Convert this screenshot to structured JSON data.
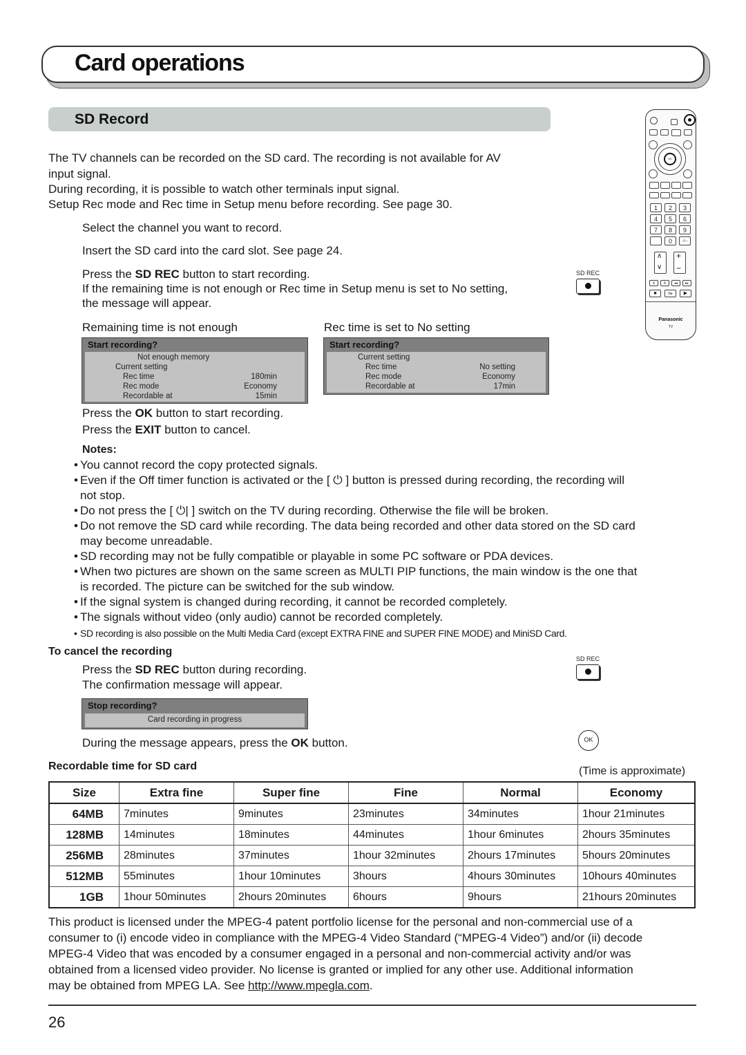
{
  "page": {
    "title": "Card operations",
    "section_title": "SD Record",
    "page_number": "26"
  },
  "intro": {
    "line1": "The TV channels can be recorded on the SD card. The recording is not available for AV",
    "line2": "input signal.",
    "line3": "During recording, it is possible to watch other terminals input signal.",
    "line4": "Setup Rec mode and Rec time in Setup menu before recording. See page 30."
  },
  "steps": {
    "step1": "Select the channel you want to record.",
    "step2": "Insert the SD card into the card slot. See page 24.",
    "step3_pre": "Press the ",
    "step3_bold": "SD REC",
    "step3_post": " button to start recording.",
    "step3_line2": "If the remaining time is not enough or Rec time in Setup menu is set to No setting,",
    "step3_line3": "the message will appear.",
    "caption_left": "Remaining time is not enough",
    "caption_right": "Rec time is set to No setting",
    "ok_pre": "Press the ",
    "ok_bold": "OK",
    "ok_post": " button to start recording.",
    "exit_pre": "Press the ",
    "exit_bold": "EXIT",
    "exit_post": " button to cancel."
  },
  "dialog_not_enough": {
    "title": "Start recording?",
    "message": "Not enough memory",
    "current_setting": "Current setting",
    "rows": [
      {
        "label": "Rec time",
        "value": "180min"
      },
      {
        "label": "Rec mode",
        "value": "Economy"
      },
      {
        "label": "Recordable at",
        "value": "15min"
      }
    ]
  },
  "dialog_no_setting": {
    "title": "Start recording?",
    "current_setting": "Current setting",
    "rows": [
      {
        "label": "Rec time",
        "value": "No setting"
      },
      {
        "label": "Rec mode",
        "value": "Economy"
      },
      {
        "label": "Recordable at",
        "value": "17min"
      }
    ]
  },
  "buttons": {
    "sd_rec_label": "SD REC",
    "ok_label": "OK"
  },
  "notes": {
    "heading": "Notes:",
    "items": [
      "You cannot record the copy protected signals.",
      "Even if the Off timer function is activated or the [ ⏻ ] button is pressed during recording, the recording will",
      "not stop.",
      "Do not press the [ ⏻| ] switch on the TV during recording. Otherwise the file will be broken.",
      "Do not remove the SD card while recording. The data being recorded and other data stored on the SD card",
      "may become unreadable.",
      "SD recording may not be fully compatible or playable in some PC software or PDA devices.",
      "When two pictures are shown on the same screen as MULTI PIP functions, the main window is the one that",
      "is recorded. The picture can be switched for the sub window.",
      "If the signal system is changed during recording, it cannot be recorded completely.",
      "The signals without video (only audio) cannot be recorded completely.",
      "SD recording is also possible on the Multi Media Card (except EXTRA FINE and SUPER FINE MODE) and MiniSD Card."
    ]
  },
  "cancel": {
    "heading": "To cancel the recording",
    "line1_pre": "Press the ",
    "line1_bold": "SD REC",
    "line1_post": " button during recording.",
    "line2": "The confirmation message will appear.",
    "dialog_title": "Stop recording?",
    "dialog_message": "Card recording in progress",
    "line3_pre": "During the message appears, press the ",
    "line3_bold": "OK",
    "line3_post": " button."
  },
  "table": {
    "heading": "Recordable time for SD card",
    "note": "(Time is approximate)",
    "headers": [
      "Size",
      "Extra fine",
      "Super fine",
      "Fine",
      "Normal",
      "Economy"
    ],
    "rows": [
      [
        "64MB",
        "7minutes",
        "9minutes",
        "23minutes",
        "34minutes",
        "1hour 21minutes"
      ],
      [
        "128MB",
        "14minutes",
        "18minutes",
        "44minutes",
        "1hour 6minutes",
        "2hours 35minutes"
      ],
      [
        "256MB",
        "28minutes",
        "37minutes",
        "1hour 32minutes",
        "2hours 17minutes",
        "5hours 20minutes"
      ],
      [
        "512MB",
        "55minutes",
        "1hour 10minutes",
        "3hours",
        "4hours 30minutes",
        "10hours 40minutes"
      ],
      [
        "1GB",
        "1hour 50minutes",
        "2hours 20minutes",
        "6hours",
        "9hours",
        "21hours 20minutes"
      ]
    ]
  },
  "license": {
    "line1": "This product is licensed under the MPEG-4 patent portfolio license for the personal and non-commercial use of a",
    "line2": "consumer to (i) encode video in compliance with the MPEG-4 Video Standard (“MPEG-4 Video”) and/or (ii) decode",
    "line3": "MPEG-4 Video that was encoded by a consumer engaged in a personal and non-commercial activity and/or was",
    "line4": "obtained from a licensed video provider. No license is granted or implied for any other use. Additional information",
    "line5_pre": "may be obtained from MPEG LA. See ",
    "line5_link": "http://www.mpegla.com",
    "line5_post": "."
  },
  "remote": {
    "brand": "Panasonic",
    "model": "TV",
    "ok": "OK",
    "digits": [
      "1",
      "2",
      "3",
      "4",
      "5",
      "6",
      "7",
      "8",
      "9"
    ],
    "zero": "0",
    "dash": "-/--"
  }
}
